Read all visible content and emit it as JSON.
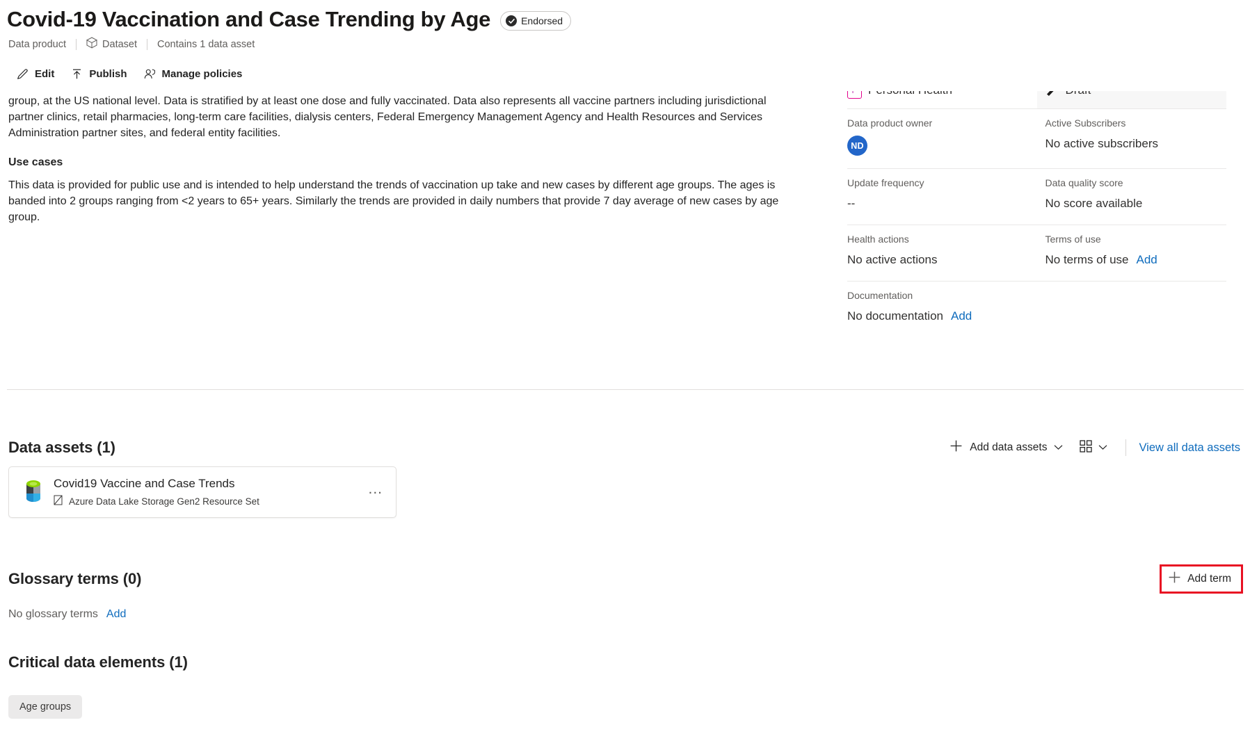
{
  "header": {
    "title": "Covid-19 Vaccination and Case Trending by Age",
    "endorsed_label": "Endorsed",
    "breadcrumb": {
      "kind": "Data product",
      "type": "Dataset",
      "asset_count": "Contains 1 data asset"
    },
    "commands": [
      {
        "label": "Edit",
        "icon": "pencil-icon"
      },
      {
        "label": "Publish",
        "icon": "publish-arrow-icon"
      },
      {
        "label": "Manage policies",
        "icon": "person-policy-icon"
      }
    ]
  },
  "description": {
    "paragraph1": "This data comes from the CDC as a part of the U.S. Department of Health & Human Services. The data contains trends in vaccinations and cases by age group, at the US national level. Data is stratified by at least one dose and fully vaccinated. Data also represents all vaccine partners including jurisdictional partner clinics, retail pharmacies, long-term care facilities, dialysis centers, Federal Emergency Management Agency and Health Resources and Services Administration partner sites, and federal entity facilities.",
    "use_cases_heading": "Use cases",
    "paragraph2": "This data is provided for public use and is intended to help understand the trends of vaccination up take and new cases by different age groups.  The ages is banded into 2 groups ranging from <2 years to 65+ years.  Similarly the trends are provided in daily numbers that provide 7 day average of new cases by age group."
  },
  "info_panel": {
    "classification": {
      "badge": "P",
      "label": "Personal Health"
    },
    "status": {
      "label": "Draft",
      "icon": "draft-pencil-icon"
    },
    "owner": {
      "label": "Data product owner",
      "initials": "ND",
      "name_redacted": ""
    },
    "subscribers": {
      "label": "Active Subscribers",
      "value": "No active subscribers"
    },
    "update_frequency": {
      "label": "Update frequency",
      "value": "--"
    },
    "quality_score": {
      "label": "Data quality score",
      "value": "No score available"
    },
    "health_actions": {
      "label": "Health actions",
      "value": "No active actions"
    },
    "terms_of_use": {
      "label": "Terms of use",
      "value": "No terms of use",
      "action": "Add"
    },
    "documentation": {
      "label": "Documentation",
      "value": "No documentation",
      "action": "Add"
    }
  },
  "data_assets": {
    "title": "Data assets (1)",
    "add_button": "Add data assets",
    "view_toggle_icon": "grid-view-icon",
    "view_all_link": "View all data assets",
    "items": [
      {
        "name": "Covid19 Vaccine and Case Trends",
        "type": "Azure Data Lake Storage Gen2 Resource Set",
        "icon": "adls-gen2-resource-set-icon",
        "more_label": "..."
      }
    ]
  },
  "glossary": {
    "title": "Glossary terms (0)",
    "add_button": "Add term",
    "empty_text": "No glossary terms",
    "empty_action": "Add",
    "highlight_color": "#e81123"
  },
  "critical_data_elements": {
    "title": "Critical data elements (1)",
    "chips": [
      {
        "label": "Age groups"
      }
    ]
  },
  "colors": {
    "link": "#0f6cbd",
    "classification_badge": "#c239b3",
    "avatar": "#2266c9",
    "highlight": "#e81123"
  }
}
